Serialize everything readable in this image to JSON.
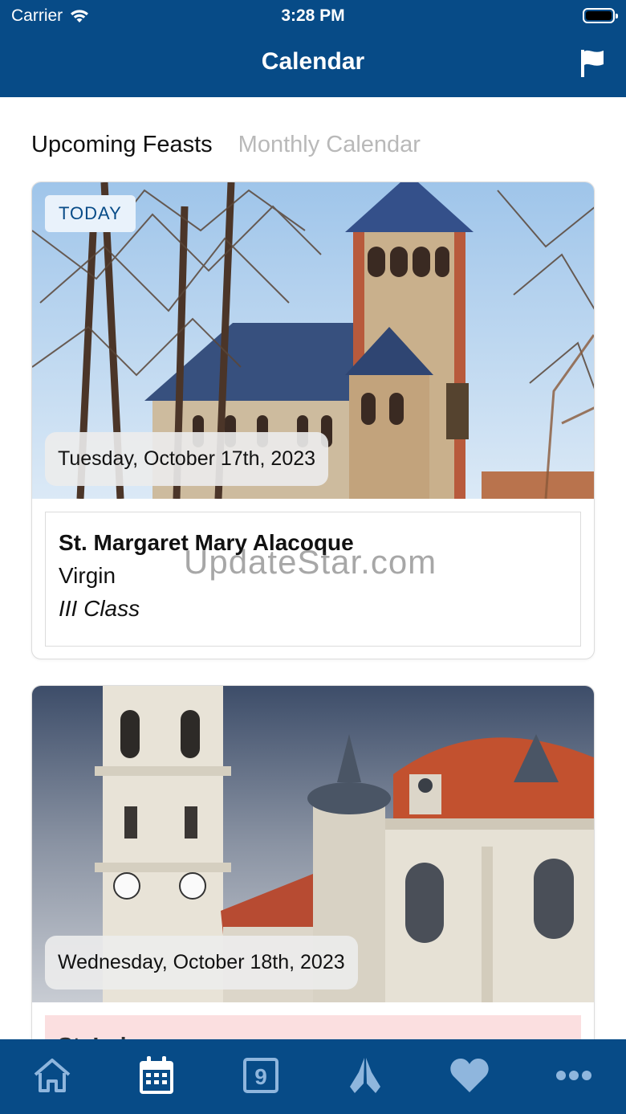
{
  "status_bar": {
    "carrier": "Carrier",
    "time": "3:28 PM"
  },
  "nav": {
    "title": "Calendar",
    "flag_icon": "flag-icon"
  },
  "segments": {
    "active": "Upcoming Feasts",
    "inactive": "Monthly Calendar"
  },
  "feasts": [
    {
      "badge": "TODAY",
      "date": "Tuesday, October 17th, 2023",
      "name": "St. Margaret Mary Alacoque",
      "type": "Virgin",
      "class": "III Class"
    },
    {
      "date": "Wednesday, October 18th, 2023",
      "name": "St. Luke"
    }
  ],
  "watermark": "UpdateStar.com",
  "tabbar": {
    "items": [
      {
        "icon": "home-icon",
        "selected": false
      },
      {
        "icon": "calendar-icon",
        "selected": true
      },
      {
        "icon": "novena-nine-icon",
        "selected": false
      },
      {
        "icon": "praying-hands-icon",
        "selected": false
      },
      {
        "icon": "heart-icon",
        "selected": false
      },
      {
        "icon": "more-icon",
        "selected": false
      }
    ],
    "active_color": "#ffffff",
    "inactive_color": "#8fb6dd"
  },
  "colors": {
    "brand": "#074b87",
    "today_badge_bg": "#e9f2fb",
    "pink_box": "#fbdfe0"
  }
}
